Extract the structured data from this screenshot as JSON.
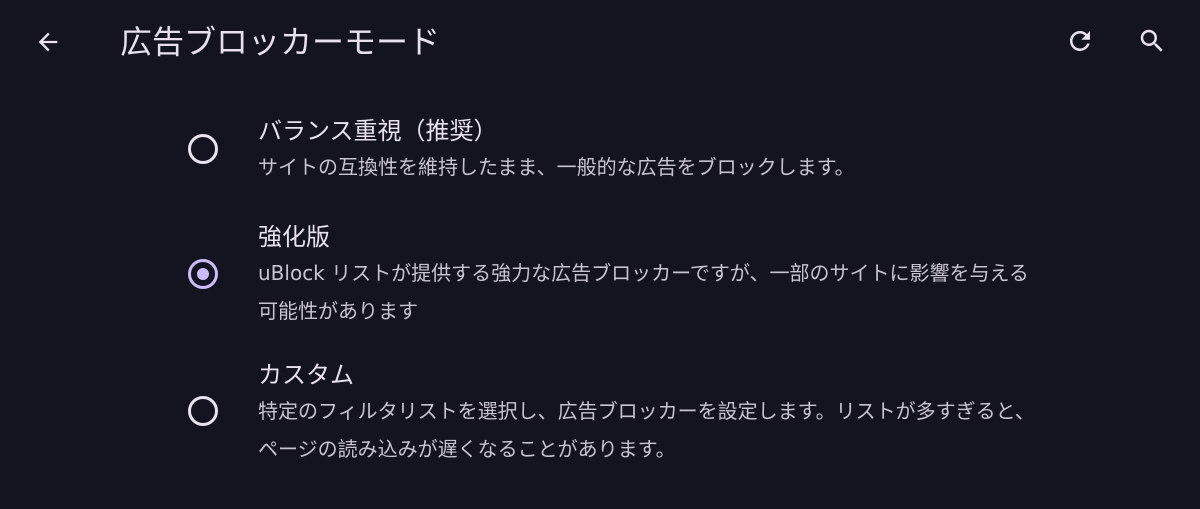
{
  "toolbar": {
    "title": "広告ブロッカーモード",
    "back_icon": "arrow-back-icon",
    "refresh_icon": "refresh-icon",
    "search_icon": "search-icon"
  },
  "colors": {
    "background": "#141320",
    "accent": "#cbbef8",
    "text_primary": "#e8e2ef",
    "text_secondary": "#c8c3d0"
  },
  "options": [
    {
      "title": "バランス重視（推奨）",
      "description": "サイトの互換性を維持したまま、一般的な広告をブロックします。",
      "selected": false
    },
    {
      "title": "強化版",
      "description": "uBlock リストが提供する強力な広告ブロッカーですが、一部のサイトに影響を与える可能性があります",
      "selected": true
    },
    {
      "title": "カスタム",
      "description": "特定のフィルタリストを選択し、広告ブロッカーを設定します。リストが多すぎると、ページの読み込みが遅くなることがあります。",
      "selected": false
    }
  ]
}
